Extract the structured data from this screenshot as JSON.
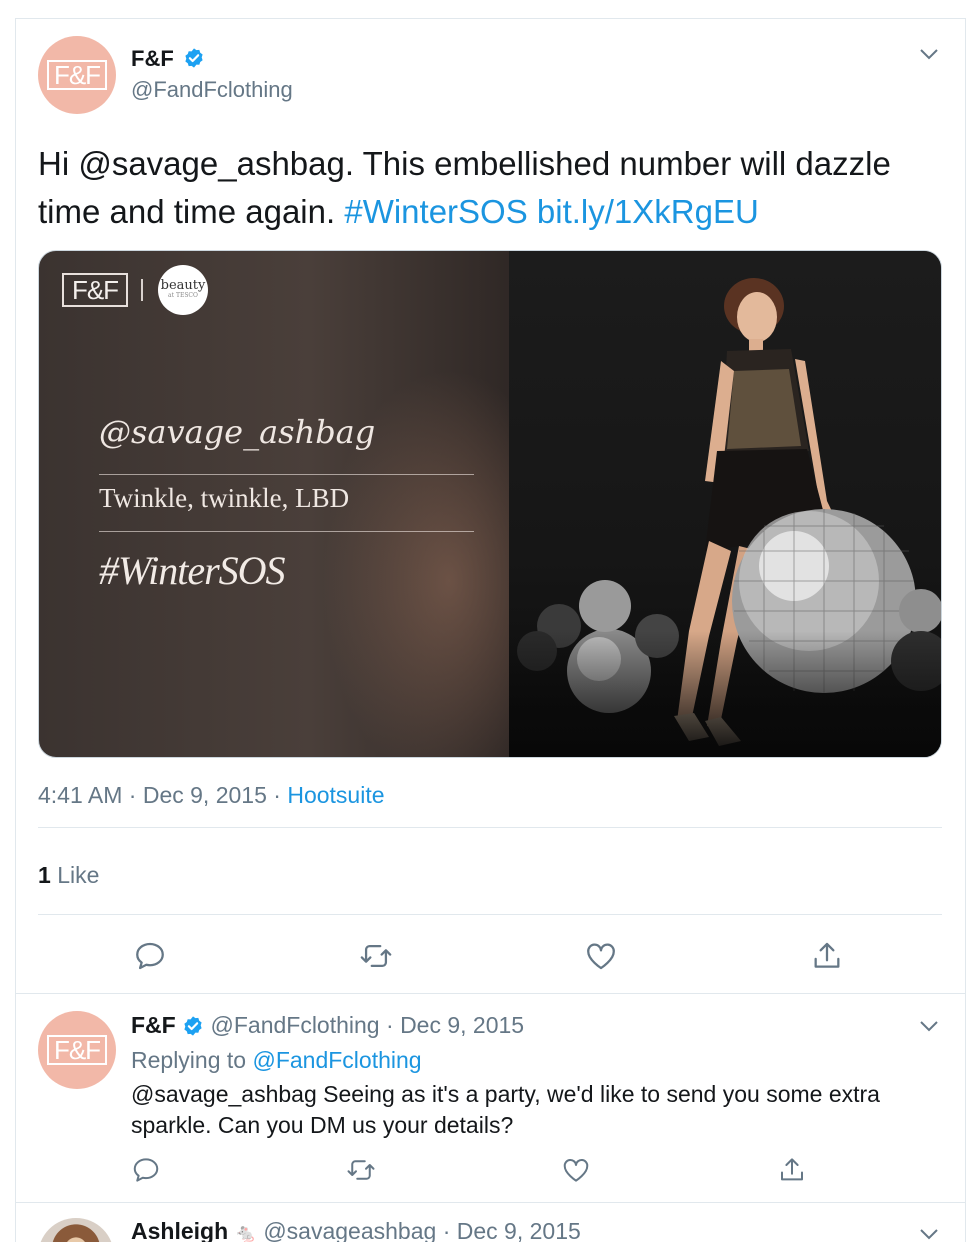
{
  "main_tweet": {
    "author_name": "F&F",
    "author_handle": "@FandFclothing",
    "avatar_logo": "F&F",
    "text_prefix": "Hi @savage_ashbag. This embellished number will dazzle time and time again. ",
    "hashtag": "#WinterSOS",
    "url": "bit.ly/1XkRgEU",
    "media": {
      "brand_logo": "F&F",
      "partner_logo": "beauty",
      "partner_logo_small": "at TESCO",
      "overlay_handle": "@savage_ashbag",
      "overlay_line": "Twinkle, twinkle, LBD",
      "overlay_hashtag": "#WinterSOS"
    },
    "time": "4:41 AM",
    "date": "Dec 9, 2015",
    "source": "Hootsuite",
    "like_count": "1",
    "like_label": "Like"
  },
  "reply_tweet": {
    "author_name": "F&F",
    "author_handle": "@FandFclothing",
    "date": "Dec 9, 2015",
    "replying_label": "Replying to",
    "replying_handle": "@FandFclothing",
    "text": "@savage_ashbag Seeing as it's a party, we'd like to send you some extra sparkle. Can you DM us your details?"
  },
  "third_tweet": {
    "author_name": "Ashleigh",
    "author_handle": "@savageashbag",
    "date": "Dec 9, 2015"
  },
  "separator": "·",
  "colors": {
    "link": "#1b95e0",
    "muted": "#657786",
    "text": "#14171a",
    "verified": "#1da1f2",
    "avatar_bg": "#f2b8a8"
  },
  "icons": [
    "verified-badge-icon",
    "chevron-down-icon",
    "reply-icon",
    "retweet-icon",
    "like-icon",
    "share-icon"
  ]
}
